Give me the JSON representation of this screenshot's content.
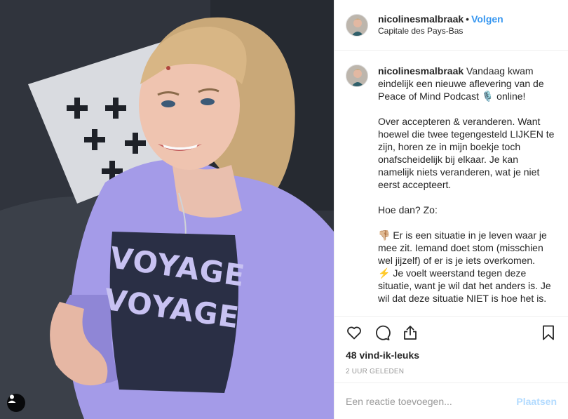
{
  "post": {
    "username": "nicolinesmalbraak",
    "separator": "•",
    "follow_label": "Volgen",
    "location": "Capitale des Pays-Bas",
    "shirt_text": [
      "VOYAGE",
      "VOYAGE"
    ]
  },
  "caption": {
    "username": "nicolinesmalbraak",
    "text": " Vandaag kwam eindelijk een nieuwe aflevering van de Peace of Mind Podcast 🎙️ online!\n\nOver accepteren & veranderen. Want hoewel die twee tegengesteld LIJKEN te zijn, horen ze in mijn boekje toch onafscheidelijk bij elkaar. Je kan namelijk niets veranderen, wat je niet eerst accepteert.\n\nHoe dan? Zo:\n\n👎🏼 Er is een situatie in je leven waar je mee zit. Iemand doet stom (misschien wel jijzelf) of er is je iets overkomen.\n⚡️ Je voelt weerstand tegen deze situatie, want je wil dat het anders is. Je wil dat deze situatie NIET is hoe het is."
  },
  "stats": {
    "likes": "48 vind-ik-leuks",
    "timestamp": "2 UUR GELEDEN"
  },
  "icons": {
    "like": "heart-icon",
    "comment": "comment-icon",
    "share": "share-icon",
    "save": "bookmark-icon",
    "user_tag": "user-tag-icon"
  },
  "comment_form": {
    "placeholder": "Een reactie toevoegen...",
    "value": "",
    "post_label": "Plaatsen"
  },
  "colors": {
    "accent": "#3897f0",
    "post_disabled": "#b3dbff",
    "sweater": "#a49be8"
  }
}
